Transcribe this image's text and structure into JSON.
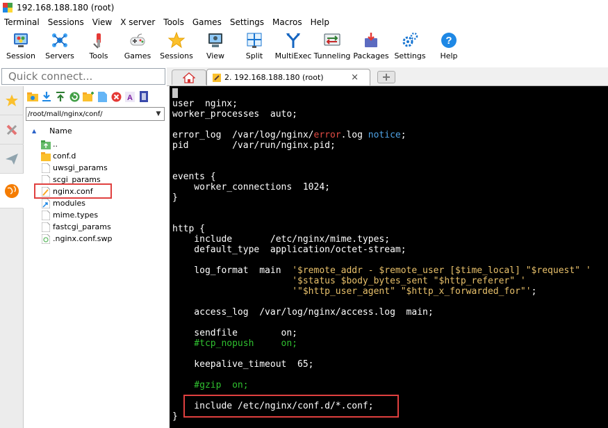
{
  "window": {
    "title": "192.168.188.180 (root)"
  },
  "menu": [
    "Terminal",
    "Sessions",
    "View",
    "X server",
    "Tools",
    "Games",
    "Settings",
    "Macros",
    "Help"
  ],
  "toolbar": [
    {
      "label": "Session",
      "icon": "session-icon"
    },
    {
      "label": "Servers",
      "icon": "servers-icon"
    },
    {
      "label": "Tools",
      "icon": "tools-icon"
    },
    {
      "label": "Games",
      "icon": "gamepad-icon"
    },
    {
      "label": "Sessions",
      "icon": "star-icon"
    },
    {
      "label": "View",
      "icon": "view-icon"
    },
    {
      "label": "Split",
      "icon": "split-icon"
    },
    {
      "label": "MultiExec",
      "icon": "multiexec-icon"
    },
    {
      "label": "Tunneling",
      "icon": "tunneling-icon"
    },
    {
      "label": "Packages",
      "icon": "packages-icon"
    },
    {
      "label": "Settings",
      "icon": "settings-icon"
    },
    {
      "label": "Help",
      "icon": "help-icon"
    }
  ],
  "quick_connect": {
    "placeholder": "Quick connect..."
  },
  "tabs": {
    "session_label": "2. 192.168.188.180 (root)",
    "close": "×"
  },
  "file_panel": {
    "path": "/root/mall/nginx/conf/",
    "name_header": "Name",
    "files": [
      {
        "name": "..",
        "icon": "parent-folder-icon"
      },
      {
        "name": "conf.d",
        "icon": "folder-icon"
      },
      {
        "name": "uwsgi_params",
        "icon": "file-icon"
      },
      {
        "name": "scgi_params",
        "icon": "file-icon"
      },
      {
        "name": "nginx.conf",
        "icon": "edit-file-icon"
      },
      {
        "name": "modules",
        "icon": "link-icon"
      },
      {
        "name": "mime.types",
        "icon": "file-icon"
      },
      {
        "name": "fastcgi_params",
        "icon": "file-icon"
      },
      {
        "name": ".nginx.conf.swp",
        "icon": "swap-file-icon"
      }
    ]
  },
  "terminal": {
    "lines": [
      [
        {
          "t": "",
          "cursor": true
        }
      ],
      [
        {
          "t": "user  nginx;"
        }
      ],
      [
        {
          "t": "worker_processes  auto;"
        }
      ],
      [
        {
          "t": ""
        }
      ],
      [
        {
          "t": "error_log  /var/log/nginx/"
        },
        {
          "t": "error",
          "c": "red"
        },
        {
          "t": ".log "
        },
        {
          "t": "notice",
          "c": "blue"
        },
        {
          "t": ";"
        }
      ],
      [
        {
          "t": "pid        /var/run/nginx.pid;"
        }
      ],
      [
        {
          "t": ""
        }
      ],
      [
        {
          "t": ""
        }
      ],
      [
        {
          "t": "events {"
        }
      ],
      [
        {
          "t": "    worker_connections  1024;"
        }
      ],
      [
        {
          "t": "}"
        }
      ],
      [
        {
          "t": ""
        }
      ],
      [
        {
          "t": ""
        }
      ],
      [
        {
          "t": "http {"
        }
      ],
      [
        {
          "t": "    include       /etc/nginx/mime.types;"
        }
      ],
      [
        {
          "t": "    default_type  application/octet-stream;"
        }
      ],
      [
        {
          "t": ""
        }
      ],
      [
        {
          "t": "    log_format  main  "
        },
        {
          "t": "'$remote_addr - $remote_user [$time_local] \"$request\" '",
          "c": "yellow"
        }
      ],
      [
        {
          "t": "                      "
        },
        {
          "t": "'$status $body_bytes_sent \"$http_referer\" '",
          "c": "yellow"
        }
      ],
      [
        {
          "t": "                      "
        },
        {
          "t": "'\"$http_user_agent\" \"$http_x_forwarded_for\"'",
          "c": "yellow"
        },
        {
          "t": ";"
        }
      ],
      [
        {
          "t": ""
        }
      ],
      [
        {
          "t": "    access_log  /var/log/nginx/access.log  main;"
        }
      ],
      [
        {
          "t": ""
        }
      ],
      [
        {
          "t": "    sendfile        on;"
        }
      ],
      [
        {
          "t": "    #tcp_nopush     on;",
          "c": "green"
        }
      ],
      [
        {
          "t": ""
        }
      ],
      [
        {
          "t": "    keepalive_timeout  65;"
        }
      ],
      [
        {
          "t": ""
        }
      ],
      [
        {
          "t": "    #gzip  on;",
          "c": "green"
        }
      ],
      [
        {
          "t": ""
        }
      ],
      [
        {
          "t": "    include /etc/nginx/conf.d/*.conf;"
        }
      ],
      [
        {
          "t": "}"
        }
      ]
    ]
  }
}
